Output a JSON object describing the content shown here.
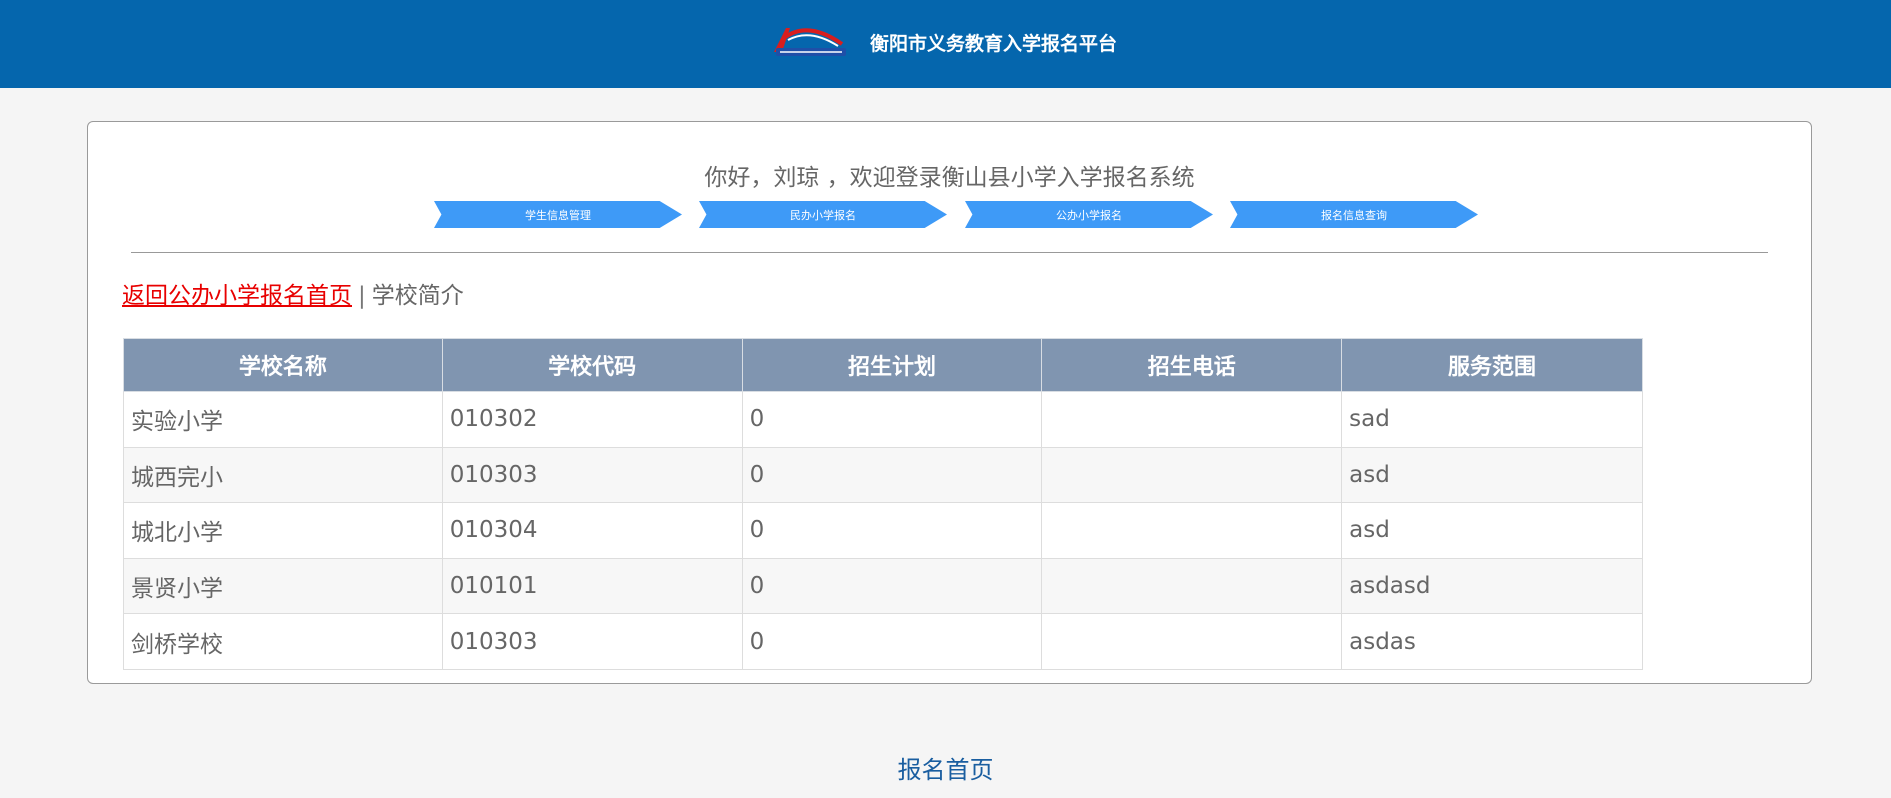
{
  "header": {
    "title": "衡阳市义务教育入学报名平台",
    "logo_icon": "platform-logo"
  },
  "welcome": "你好，刘琼 ，欢迎登录衡山县小学入学报名系统",
  "nav": [
    {
      "label": "学生信息管理"
    },
    {
      "label": "民办小学报名"
    },
    {
      "label": "公办小学报名"
    },
    {
      "label": "报名信息查询"
    }
  ],
  "breadcrumb": {
    "back_label": "返回公办小学报名首页",
    "separator": "|",
    "current": "学校简介"
  },
  "table": {
    "headers": [
      "学校名称",
      "学校代码",
      "招生计划",
      "招生电话",
      "服务范围"
    ],
    "rows": [
      [
        "实验小学",
        "010302",
        "0",
        "",
        "sad"
      ],
      [
        "城西完小",
        "010303",
        "0",
        "",
        "asd"
      ],
      [
        "城北小学",
        "010304",
        "0",
        "",
        "asd"
      ],
      [
        "景贤小学",
        "010101",
        "0",
        "",
        "asdasd"
      ],
      [
        "剑桥学校",
        "010303",
        "0",
        "",
        "asdas"
      ]
    ]
  },
  "footer": {
    "link_label": "报名首页"
  },
  "colors": {
    "header_bg": "#0566ad",
    "nav_button": "#3e9af7",
    "table_header": "#8095b0",
    "back_link": "#e80000",
    "footer_link": "#1a5ea0"
  }
}
